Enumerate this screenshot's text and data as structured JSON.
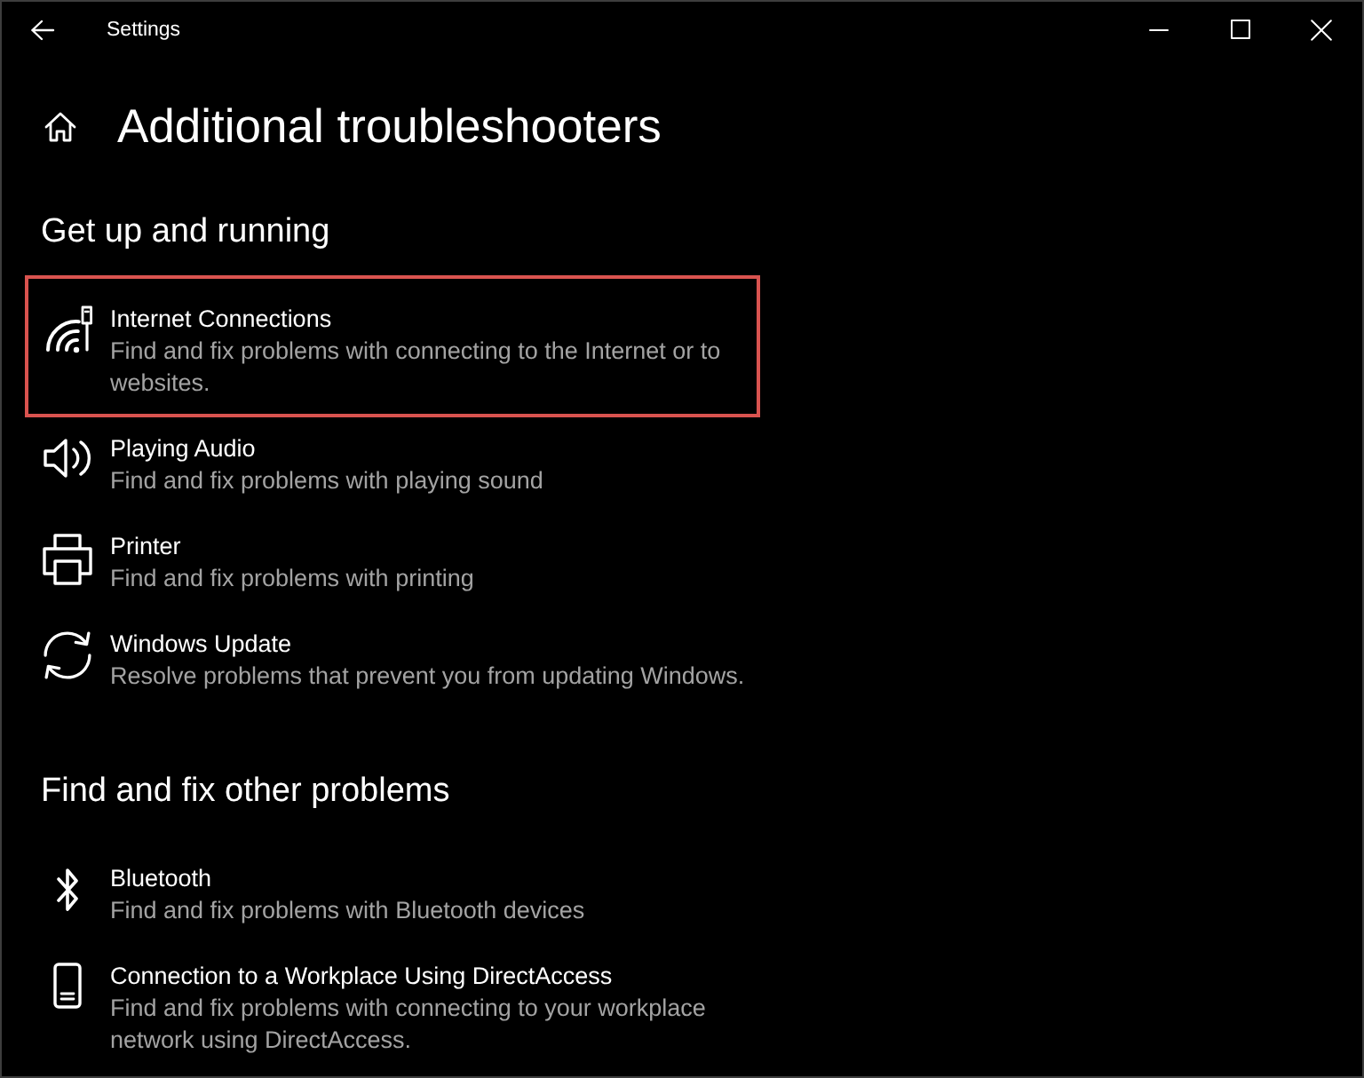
{
  "window": {
    "title": "Settings"
  },
  "page": {
    "title": "Additional troubleshooters"
  },
  "sections": [
    {
      "heading": "Get up and running",
      "items": [
        {
          "kind": "network",
          "title": "Internet Connections",
          "description": "Find and fix problems with connecting to the Internet or to websites.",
          "highlighted": true
        },
        {
          "kind": "audio",
          "title": "Playing Audio",
          "description": "Find and fix problems with playing sound",
          "highlighted": false
        },
        {
          "kind": "printer",
          "title": "Printer",
          "description": "Find and fix problems with printing",
          "highlighted": false
        },
        {
          "kind": "update",
          "title": "Windows Update",
          "description": "Resolve problems that prevent you from updating Windows.",
          "highlighted": false
        }
      ]
    },
    {
      "heading": "Find and fix other problems",
      "items": [
        {
          "kind": "bluetooth",
          "title": "Bluetooth",
          "description": "Find and fix problems with Bluetooth devices",
          "highlighted": false
        },
        {
          "kind": "device",
          "title": "Connection to a Workplace Using DirectAccess",
          "description": "Find and fix problems with connecting to your workplace network using DirectAccess.",
          "highlighted": false
        }
      ]
    }
  ]
}
